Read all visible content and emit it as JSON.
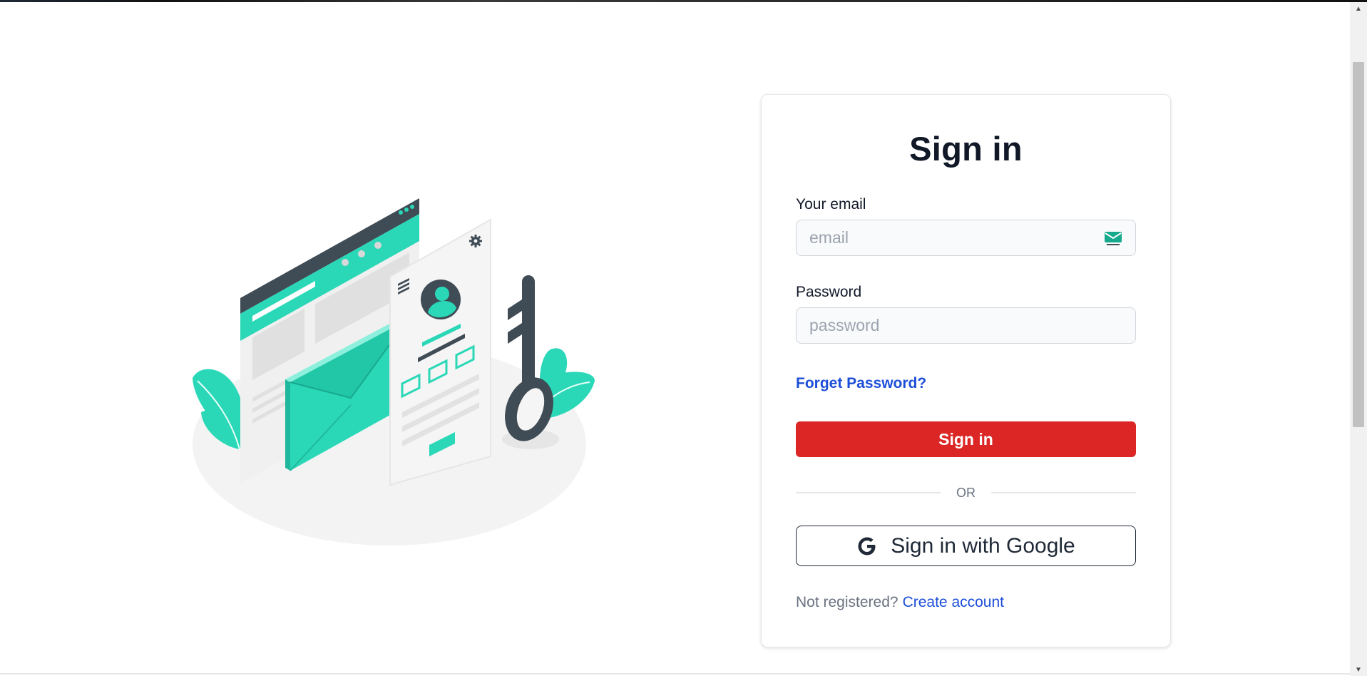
{
  "signin": {
    "title": "Sign in",
    "email_label": "Your email",
    "email_placeholder": "email",
    "password_label": "Password",
    "password_placeholder": "password",
    "forgot_label": "Forget Password?",
    "submit_label": "Sign in",
    "divider_label": "OR",
    "google_label": "Sign in with Google",
    "not_registered_text": "Not registered?",
    "create_account_label": "Create account"
  },
  "icons": {
    "email_field_icon": "mail-icon",
    "google_icon": "google-g-icon",
    "settings_icon": "gear-icon",
    "menu_icon": "hamburger-icon"
  },
  "colors": {
    "primary_button": "#dc2626",
    "link": "#1d4ed8",
    "illustration_accent": "#2ad8b8",
    "illustration_dark": "#3f4b55"
  }
}
